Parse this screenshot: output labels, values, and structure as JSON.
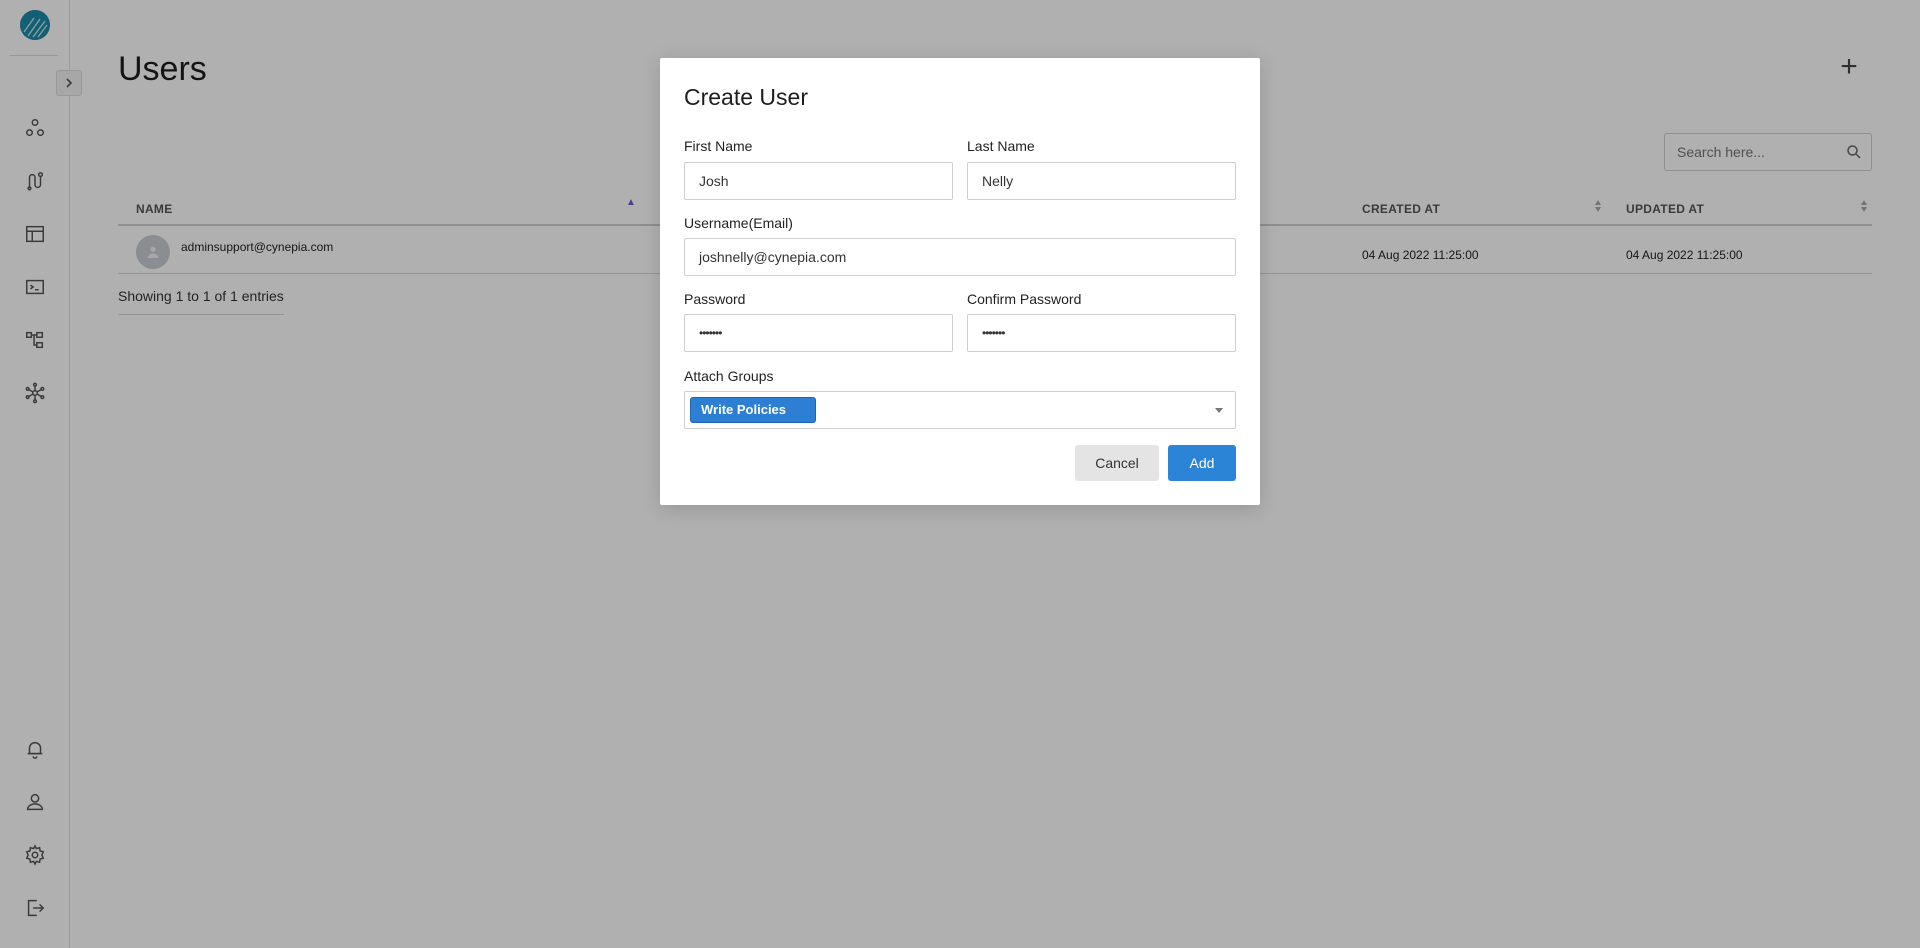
{
  "page": {
    "title": "Users",
    "add_symbol": "+",
    "search_placeholder": "Search here..."
  },
  "table": {
    "columns": [
      "NAME",
      "CREATED AT",
      "UPDATED AT"
    ],
    "rows": [
      {
        "name": "adminsupport@cynepia.com",
        "created_at": "04 Aug 2022 11:25:00",
        "updated_at": "04 Aug 2022 11:25:00"
      }
    ],
    "entries_text": "Showing 1 to 1 of 1 entries"
  },
  "modal": {
    "title": "Create User",
    "first_name": {
      "label": "First Name",
      "value": "Josh"
    },
    "last_name": {
      "label": "Last Name",
      "value": "Nelly"
    },
    "username": {
      "label": "Username(Email)",
      "value": "joshnelly@cynepia.com"
    },
    "password": {
      "label": "Password",
      "value": "•••••••"
    },
    "confirm_password": {
      "label": "Confirm Password",
      "value": "•••••••"
    },
    "groups": {
      "label": "Attach Groups",
      "selected": [
        "Write Policies"
      ]
    },
    "cancel_label": "Cancel",
    "add_label": "Add"
  },
  "sidebar": {
    "icons": [
      "nodes-icon",
      "workflow-icon",
      "table-icon",
      "terminal-icon",
      "hierarchy-icon",
      "network-icon",
      "bell-icon",
      "user-icon",
      "gear-icon",
      "logout-icon"
    ]
  },
  "colors": {
    "accent": "#2c84d6",
    "chip": "#2c7fd2",
    "logo": "#1e8aa8",
    "sort_active": "#6b5bd6"
  }
}
